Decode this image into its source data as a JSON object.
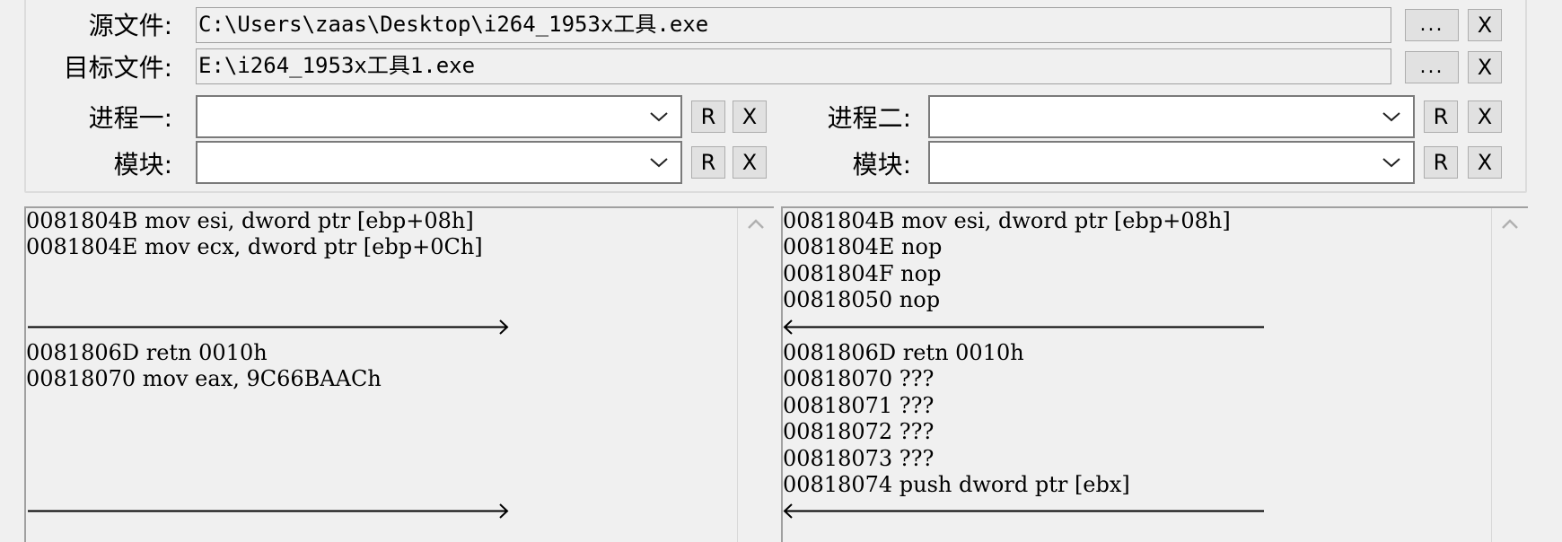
{
  "form": {
    "source_label": "源文件:",
    "source_path": "C:\\Users\\zaas\\Desktop\\i264_1953x工具.exe",
    "target_label": "目标文件:",
    "target_path": "E:\\i264_1953x工具1.exe",
    "browse_label": "...",
    "clear_label": "X",
    "process1_label": "进程一:",
    "process2_label": "进程二:",
    "module_label": "模块:",
    "refresh_label": "R",
    "process1_value": "",
    "process2_value": "",
    "module1_value": "",
    "module2_value": ""
  },
  "left_pane": {
    "lines": [
      {
        "text": "0081804B mov esi, dword ptr [ebp+08h]",
        "row": 0
      },
      {
        "text": "0081804E mov ecx, dword ptr [ebp+0Ch]",
        "row": 1
      },
      {
        "text": "0081806D retn 0010h",
        "row": 5
      },
      {
        "text": "00818070 mov eax, 9C66BAACh",
        "row": 6
      }
    ],
    "arrows": [
      {
        "row": 4,
        "direction": "right"
      },
      {
        "row": 11,
        "direction": "right"
      }
    ]
  },
  "right_pane": {
    "lines": [
      {
        "text": "0081804B mov esi, dword ptr [ebp+08h]",
        "row": 0
      },
      {
        "text": "0081804E nop",
        "row": 1
      },
      {
        "text": "0081804F nop",
        "row": 2
      },
      {
        "text": "00818050 nop",
        "row": 3
      },
      {
        "text": "0081806D retn 0010h",
        "row": 5
      },
      {
        "text": "00818070 ???",
        "row": 6
      },
      {
        "text": "00818071 ???",
        "row": 7
      },
      {
        "text": "00818072 ???",
        "row": 8
      },
      {
        "text": "00818073 ???",
        "row": 9
      },
      {
        "text": "00818074 push dword ptr [ebx]",
        "row": 10
      }
    ],
    "arrows": [
      {
        "row": 4,
        "direction": "left"
      },
      {
        "row": 11,
        "direction": "left"
      }
    ]
  }
}
